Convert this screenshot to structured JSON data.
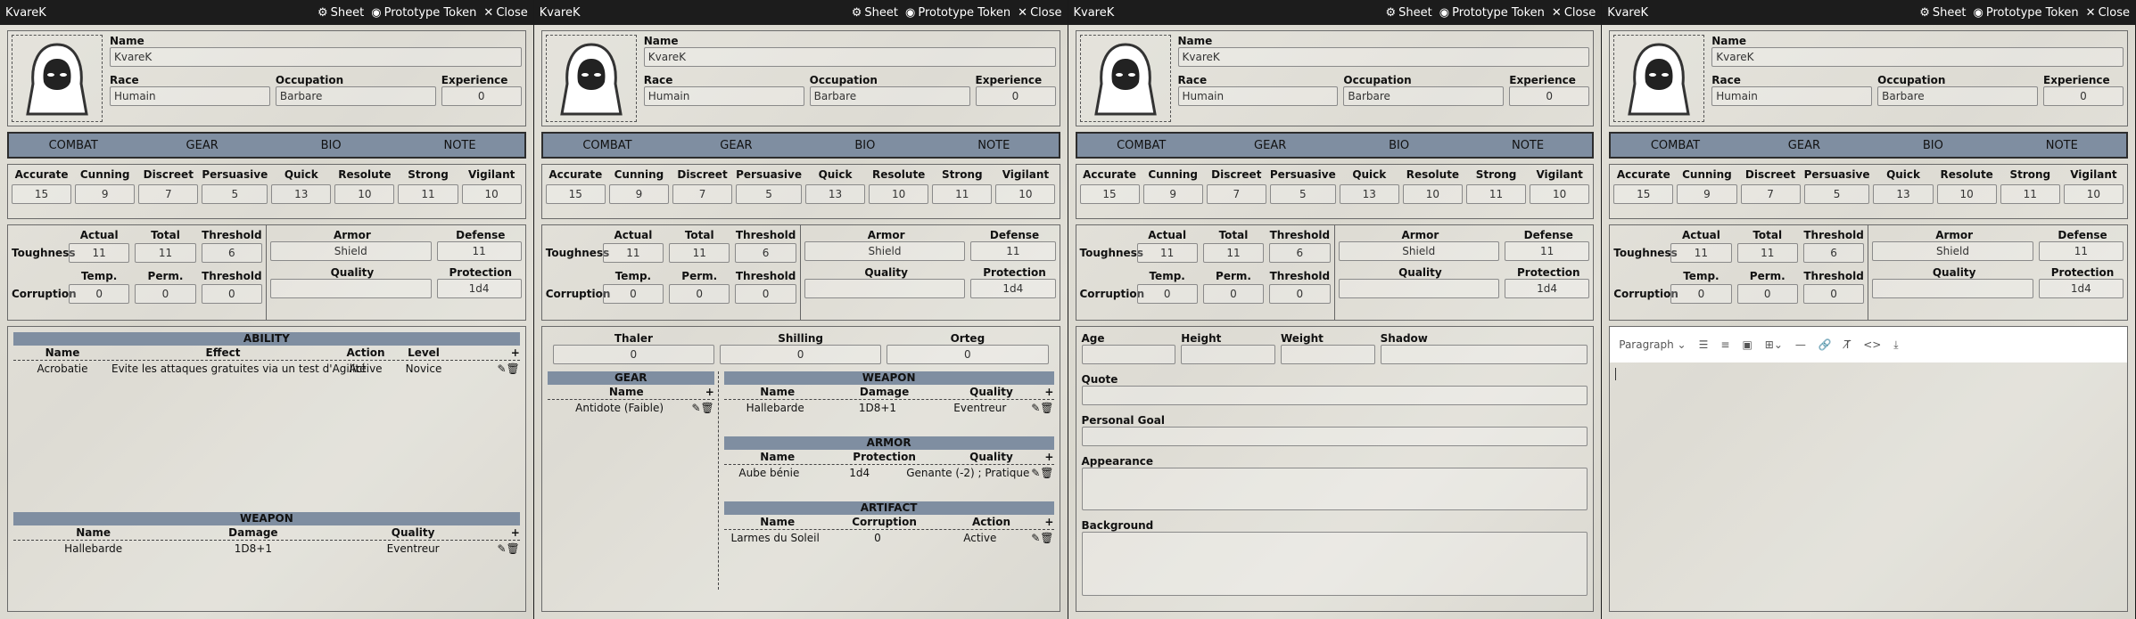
{
  "app": {
    "title": "KvareK",
    "sheet": "Sheet",
    "proto": "Prototype Token",
    "close": "Close"
  },
  "hdr": {
    "name_label": "Name",
    "name": "KvareK",
    "race_label": "Race",
    "race": "Humain",
    "occ_label": "Occupation",
    "occ": "Barbare",
    "exp_label": "Experience",
    "exp": "0"
  },
  "tabs": [
    "COMBAT",
    "GEAR",
    "BIO",
    "NOTE"
  ],
  "attributes": [
    {
      "n": "Accurate",
      "v": "15"
    },
    {
      "n": "Cunning",
      "v": "9"
    },
    {
      "n": "Discreet",
      "v": "7"
    },
    {
      "n": "Persuasive",
      "v": "5"
    },
    {
      "n": "Quick",
      "v": "13"
    },
    {
      "n": "Resolute",
      "v": "10"
    },
    {
      "n": "Strong",
      "v": "11"
    },
    {
      "n": "Vigilant",
      "v": "10"
    }
  ],
  "tough": {
    "toughness": "Toughness",
    "corruption": "Corruption",
    "actual": "Actual",
    "total": "Total",
    "threshold": "Threshold",
    "temp": "Temp.",
    "perm": "Perm.",
    "t_actual": "11",
    "t_total": "11",
    "t_thr": "6",
    "c_temp": "0",
    "c_perm": "0",
    "c_thr": "0",
    "armor": "Armor",
    "armor_v": "Shield",
    "defense": "Defense",
    "defense_v": "11",
    "quality": "Quality",
    "quality_v": "",
    "protection": "Protection",
    "protection_v": "1d4"
  },
  "combat": {
    "ability_title": "ABILITY",
    "ability_cols": [
      "Name",
      "Effect",
      "Action",
      "Level"
    ],
    "ability_row": [
      "Acrobatie",
      "Evite les attaques gratuites via un test d'Agilité",
      "Active",
      "Novice"
    ],
    "weapon_title": "WEAPON",
    "weapon_cols": [
      "Name",
      "Damage",
      "Quality"
    ],
    "weapon_row": [
      "Hallebarde",
      "1D8+1",
      "Eventreur"
    ]
  },
  "gear": {
    "thaler": "Thaler",
    "shilling": "Shilling",
    "orteg": "Orteg",
    "thaler_v": "0",
    "shilling_v": "0",
    "orteg_v": "0",
    "gear_title": "GEAR",
    "gear_col": "Name",
    "gear_row": "Antidote (Faible)",
    "weapon_title": "WEAPON",
    "weapon_cols": [
      "Name",
      "Damage",
      "Quality"
    ],
    "weapon_row": [
      "Hallebarde",
      "1D8+1",
      "Eventreur"
    ],
    "armor_title": "ARMOR",
    "armor_cols": [
      "Name",
      "Protection",
      "Quality"
    ],
    "armor_row": [
      "Aube bénie",
      "1d4",
      "Genante (-2) ; Pratique"
    ],
    "artifact_title": "ARTIFACT",
    "artifact_cols": [
      "Name",
      "Corruption",
      "Action"
    ],
    "artifact_row": [
      "Larmes du Soleil",
      "0",
      "Active"
    ]
  },
  "bio": {
    "age": "Age",
    "height": "Height",
    "weight": "Weight",
    "shadow": "Shadow",
    "quote": "Quote",
    "goal": "Personal Goal",
    "appearance": "Appearance",
    "background": "Background"
  },
  "note": {
    "paragraph": "Paragraph"
  }
}
